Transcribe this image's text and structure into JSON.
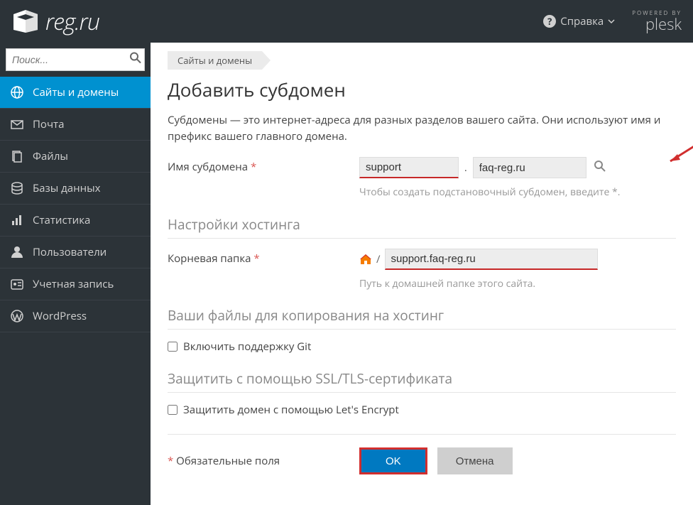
{
  "header": {
    "logo_text": "reg.ru",
    "help_label": "Справка",
    "powered_by": "POWERED BY",
    "brand": "plesk"
  },
  "sidebar": {
    "search_placeholder": "Поиск...",
    "items": [
      {
        "label": "Сайты и домены",
        "icon": "globe-icon",
        "active": true
      },
      {
        "label": "Почта",
        "icon": "mail-icon",
        "active": false
      },
      {
        "label": "Файлы",
        "icon": "files-icon",
        "active": false
      },
      {
        "label": "Базы данных",
        "icon": "database-icon",
        "active": false
      },
      {
        "label": "Статистика",
        "icon": "stats-icon",
        "active": false
      },
      {
        "label": "Пользователи",
        "icon": "user-icon",
        "active": false
      },
      {
        "label": "Учетная запись",
        "icon": "account-icon",
        "active": false
      },
      {
        "label": "WordPress",
        "icon": "wordpress-icon",
        "active": false
      }
    ]
  },
  "main": {
    "breadcrumb": "Сайты и домены",
    "title": "Добавить субдомен",
    "intro": "Субдомены — это интернет-адреса для разных разделов вашего сайта. Они используют имя и префикс вашего главного домена.",
    "subdomain": {
      "label": "Имя субдомена",
      "value": "support",
      "dot": ".",
      "domain_value": "faq-reg.ru",
      "hint": "Чтобы создать подстановочный субдомен, введите *."
    },
    "hosting": {
      "heading": "Настройки хостинга",
      "root_label": "Корневая папка",
      "slash": "/",
      "folder_value": "support.faq-reg.ru",
      "folder_hint": "Путь к домашней папке этого сайта."
    },
    "copy_files": {
      "heading": "Ваши файлы для копирования на хостинг",
      "git_label": "Включить поддержку Git"
    },
    "ssl": {
      "heading": "Защитить с помощью SSL/TLS-сертификата",
      "le_label": "Защитить домен с помощью Let's Encrypt"
    },
    "footer": {
      "required_note": "Обязательные поля",
      "ok": "OK",
      "cancel": "Отмена"
    }
  }
}
